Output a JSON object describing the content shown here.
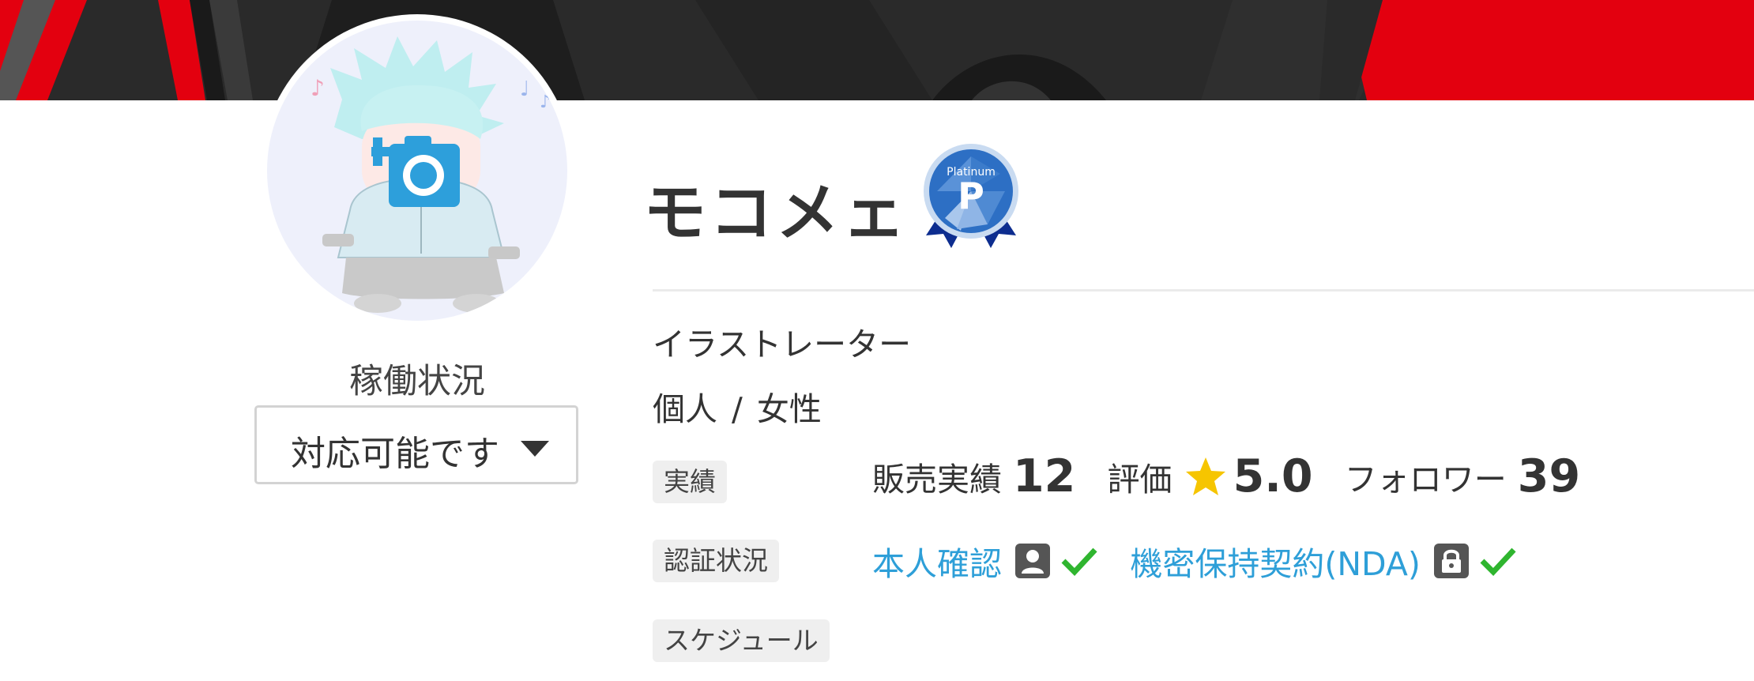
{
  "profile": {
    "name": "モコメェ",
    "badge_text": "Platinum",
    "badge_letter": "P",
    "occupation": "イラストレーター",
    "type": "個人",
    "separator": "/",
    "gender": "女性"
  },
  "availability": {
    "label": "稼働状況",
    "value": "対応可能です"
  },
  "sections": {
    "achievements": "実績",
    "verification": "認証状況",
    "schedule": "スケジュール"
  },
  "stats": {
    "sales_label": "販売実績",
    "sales_value": "12",
    "rating_label": "評価",
    "rating_value": "5.0",
    "followers_label": "フォロワー",
    "followers_value": "39"
  },
  "verifications": {
    "identity": "本人確認",
    "nda": "機密保持契約(NDA)"
  },
  "icons": {
    "camera": "camera-plus-icon",
    "caret": "caret-down-icon",
    "star": "star-icon",
    "person": "person-icon",
    "lock": "lock-icon",
    "check": "check-icon"
  },
  "colors": {
    "accent_blue": "#2e9fd8",
    "check_green": "#2fb52f",
    "star_yellow": "#f6c500",
    "badge_blue": "#2d6fc4",
    "cover_red": "#e3000f"
  }
}
